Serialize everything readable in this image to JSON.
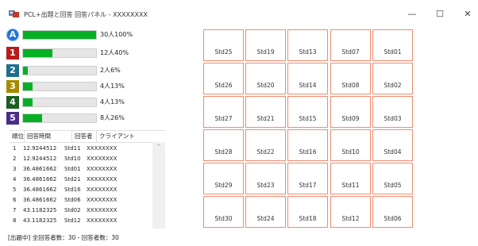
{
  "window": {
    "title": "PCL+出題と回答 回答パネル - XXXXXXXX",
    "minimize": "—",
    "maximize": "☐",
    "close": "✕"
  },
  "options": [
    {
      "label": "A",
      "color": "#1e73d8",
      "shape": "circle",
      "fraction": 1.0,
      "text": "30人100%"
    },
    {
      "label": "1",
      "color": "#b71c1c",
      "shape": "square",
      "fraction": 0.4,
      "text": "12人40%"
    },
    {
      "label": "2",
      "color": "#1e6f8e",
      "shape": "square",
      "fraction": 0.06,
      "text": "2人6%"
    },
    {
      "label": "3",
      "color": "#a88a00",
      "shape": "square",
      "fraction": 0.13,
      "text": "4人13%"
    },
    {
      "label": "4",
      "color": "#1b5e20",
      "shape": "square",
      "fraction": 0.13,
      "text": "4人13%"
    },
    {
      "label": "5",
      "color": "#4a2c8a",
      "shape": "square",
      "fraction": 0.26,
      "text": "8人26%"
    }
  ],
  "table": {
    "headers": [
      "順位",
      "回答時間",
      "回答者",
      "クライアント"
    ],
    "rows": [
      [
        "1",
        "12.9244512",
        "Std11",
        "XXXXXXXX"
      ],
      [
        "2",
        "12.9244512",
        "Std10",
        "XXXXXXXX"
      ],
      [
        "3",
        "36.4861662",
        "Std01",
        "XXXXXXXX"
      ],
      [
        "4",
        "36.4861662",
        "Std21",
        "XXXXXXXX"
      ],
      [
        "5",
        "36.4861662",
        "Std16",
        "XXXXXXXX"
      ],
      [
        "6",
        "36.4861662",
        "Std06",
        "XXXXXXXX"
      ],
      [
        "7",
        "43.1182325",
        "Std02",
        "XXXXXXXX"
      ],
      [
        "8",
        "43.1182325",
        "Std12",
        "XXXXXXXX"
      ]
    ],
    "scroll_up": "^"
  },
  "status": "[出題中] 全回答者数：30 - 回答者数：30",
  "students": [
    [
      "Std25",
      "Std19",
      "Std13",
      "Std07",
      "Std01"
    ],
    [
      "Std26",
      "Std20",
      "Std14",
      "Std08",
      "Std02"
    ],
    [
      "Std27",
      "Std21",
      "Std15",
      "Std09",
      "Std03"
    ],
    [
      "Std28",
      "Std22",
      "Std16",
      "Std10",
      "Std04"
    ],
    [
      "Std29",
      "Std23",
      "Std17",
      "Std11",
      "Std05"
    ],
    [
      "Std30",
      "Std24",
      "Std18",
      "Std12",
      "Std06"
    ]
  ],
  "cell_border_color": "#f08c70",
  "bar_color": "#06b025"
}
